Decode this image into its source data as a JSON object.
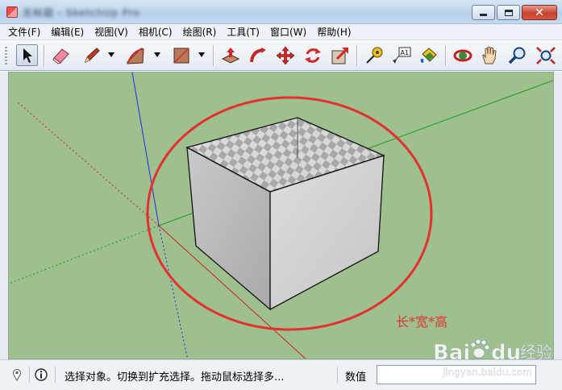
{
  "window": {
    "title": "无标题 - SketchUp Pro",
    "buttons": {
      "minimize": "minimize",
      "maximize": "maximize",
      "close": "✕"
    }
  },
  "menu": [
    "文件(F)",
    "编辑(E)",
    "视图(V)",
    "相机(C)",
    "绘图(R)",
    "工具(T)",
    "窗口(W)",
    "帮助(H)"
  ],
  "toolbar": {
    "tools": [
      "select-arrow-icon",
      "eraser-icon",
      "pencil-icon",
      "arc-icon",
      "rectangle-icon",
      "push-pull-icon",
      "follow-me-icon",
      "move-icon",
      "rotate-icon",
      "scale-icon",
      "tape-measure-icon",
      "text-label-icon",
      "paint-bucket-icon",
      "orbit-icon",
      "pan-hand-icon",
      "zoom-icon",
      "zoom-extents-icon"
    ],
    "text_tool_label": "A1"
  },
  "viewport": {
    "background": "#9ebf8e",
    "annotation": "长*宽*高",
    "annotation_color": "#e23434"
  },
  "statusbar": {
    "message": "选择对象。切换到扩充选择。拖动鼠标选择多...",
    "value_label": "数值",
    "value": ""
  },
  "watermark": {
    "brand_prefix": "Bai",
    "brand_suffix": "du",
    "brand_cn": "经验",
    "url": "jingyan.baidu.com"
  }
}
